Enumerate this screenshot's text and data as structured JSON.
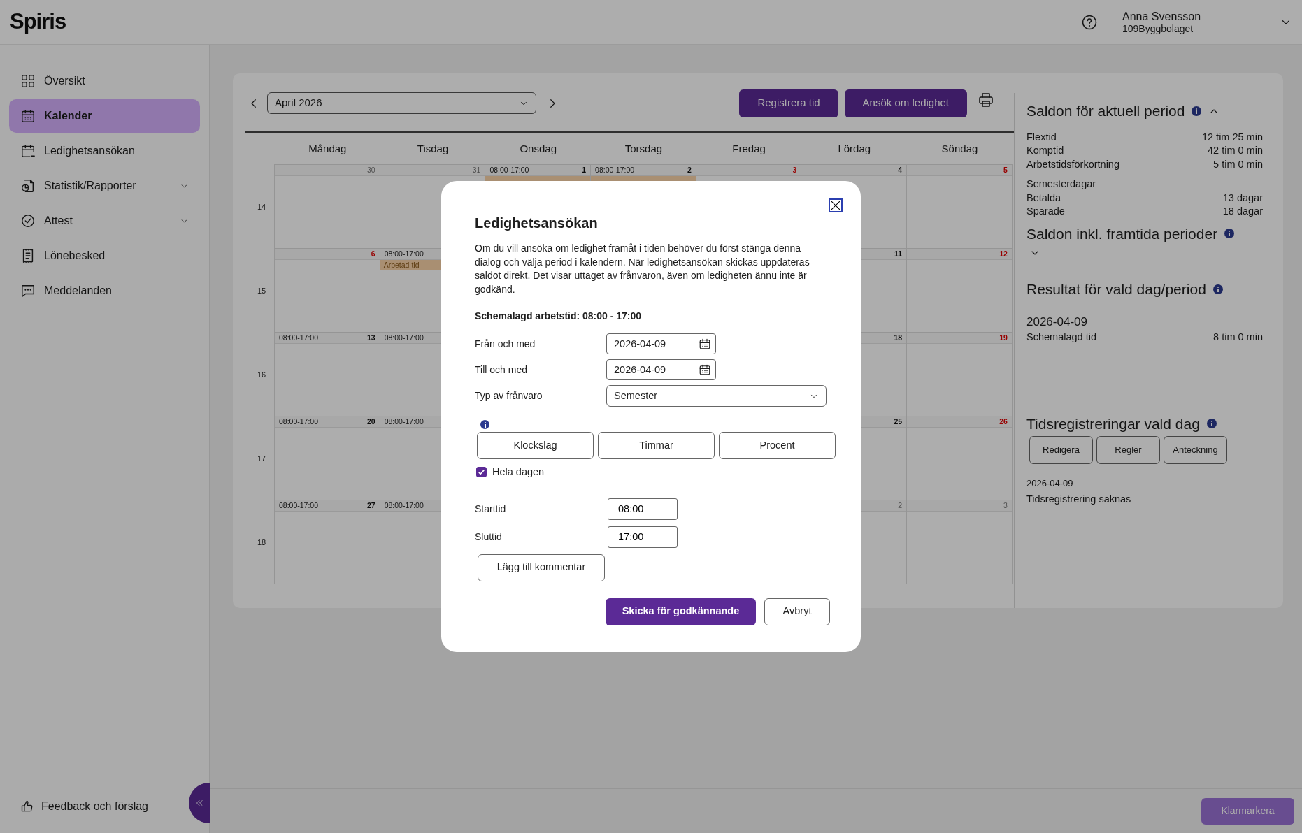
{
  "app": {
    "logo": "Spiris"
  },
  "user": {
    "name": "Anna Svensson",
    "company": "109Byggbolaget"
  },
  "sidebar": {
    "items": [
      {
        "label": "Översikt",
        "selected": false,
        "expandable": false
      },
      {
        "label": "Kalender",
        "selected": true,
        "expandable": false
      },
      {
        "label": "Ledighetsansökan",
        "selected": false,
        "expandable": false
      },
      {
        "label": "Statistik/Rapporter",
        "selected": false,
        "expandable": true
      },
      {
        "label": "Attest",
        "selected": false,
        "expandable": true
      },
      {
        "label": "Lönebesked",
        "selected": false,
        "expandable": false
      },
      {
        "label": "Meddelanden",
        "selected": false,
        "expandable": false
      }
    ],
    "feedback": "Feedback och förslag"
  },
  "calendar": {
    "month": "April 2026",
    "buttons": [
      "Registrera tid",
      "Ansök om ledighet"
    ],
    "weekdays": [
      "Måndag",
      "Tisdag",
      "Onsdag",
      "Torsdag",
      "Fredag",
      "Lördag",
      "Söndag"
    ],
    "weeks": [
      {
        "number": "14",
        "days": [
          {
            "kind": "day",
            "day": "30",
            "holiday": false,
            "other_month": true
          },
          {
            "kind": "day",
            "day": "31",
            "holiday": false,
            "other_month": true
          },
          {
            "kind": "day",
            "time": "08:00-17:00",
            "day": "1",
            "holiday": false,
            "other_month": false,
            "event": true
          },
          {
            "kind": "day",
            "time": "08:00-17:00",
            "day": "2",
            "holiday": false,
            "other_month": false,
            "event": true
          },
          {
            "kind": "day",
            "day": "3",
            "holiday": true,
            "other_month": false
          },
          {
            "kind": "day",
            "day": "4",
            "holiday": false,
            "other_month": false
          },
          {
            "kind": "day",
            "day": "5",
            "holiday": true,
            "other_month": false
          }
        ]
      },
      {
        "number": "15",
        "days": [
          {
            "kind": "day",
            "day": "6",
            "holiday": true,
            "other_month": false
          },
          {
            "kind": "day",
            "time": "08:00-17:00",
            "event": true,
            "event_label": "Arbetad tid"
          },
          {
            "kind": "covered"
          },
          {
            "kind": "covered"
          },
          {
            "kind": "covered"
          },
          {
            "kind": "day",
            "day": "11",
            "holiday": false,
            "other_month": false
          },
          {
            "kind": "day",
            "day": "12",
            "holiday": true,
            "other_month": false
          }
        ]
      },
      {
        "number": "16",
        "days": [
          {
            "kind": "day",
            "time": "08:00-17:00",
            "day": "13",
            "holiday": false,
            "other_month": false
          },
          {
            "kind": "day",
            "time": "08:00-17:00"
          },
          {
            "kind": "covered"
          },
          {
            "kind": "covered"
          },
          {
            "kind": "covered"
          },
          {
            "kind": "day",
            "day": "18",
            "holiday": false,
            "other_month": false
          },
          {
            "kind": "day",
            "day": "19",
            "holiday": true,
            "other_month": false
          }
        ]
      },
      {
        "number": "17",
        "days": [
          {
            "kind": "day",
            "time": "08:00-17:00",
            "day": "20",
            "holiday": false,
            "other_month": false
          },
          {
            "kind": "day",
            "time": "08:00-17:00"
          },
          {
            "kind": "covered"
          },
          {
            "kind": "covered"
          },
          {
            "kind": "covered"
          },
          {
            "kind": "day",
            "day": "25",
            "holiday": false,
            "other_month": false
          },
          {
            "kind": "day",
            "day": "26",
            "holiday": true,
            "other_month": false
          }
        ]
      },
      {
        "number": "18",
        "days": [
          {
            "kind": "day",
            "time": "08:00-17:00",
            "day": "27",
            "holiday": false,
            "other_month": false
          },
          {
            "kind": "day",
            "time": "08:00-17:00"
          },
          {
            "kind": "covered"
          },
          {
            "kind": "covered"
          },
          {
            "kind": "covered"
          },
          {
            "kind": "day",
            "day": "2",
            "holiday": false,
            "other_month": true
          },
          {
            "kind": "day",
            "day": "3",
            "holiday": false,
            "other_month": true
          }
        ]
      }
    ]
  },
  "balances": {
    "title": "Saldon för aktuell period",
    "expanded": true,
    "rows": [
      {
        "label": "Flextid",
        "value": "12 tim 25 min"
      },
      {
        "label": "Komptid",
        "value": "42 tim 0 min"
      },
      {
        "label": "Arbetstidsförkortning",
        "value": "5 tim 0 min"
      }
    ],
    "vacation_title": "Semesterdagar",
    "vacation_rows": [
      {
        "label": "Betalda",
        "value": "13 dagar"
      },
      {
        "label": "Sparade",
        "value": "18 dagar"
      }
    ]
  },
  "future_balances": {
    "title": "Saldon inkl. framtida perioder",
    "expanded": false
  },
  "result": {
    "title": "Resultat för vald dag/period",
    "date": "2026-04-09",
    "rows": [
      {
        "label": "Schemalagd tid",
        "value": "8 tim 0 min"
      }
    ]
  },
  "registrations": {
    "title": "Tidsregistreringar vald dag",
    "buttons": [
      "Redigera",
      "Regler",
      "Anteckning"
    ],
    "date": "2026-04-09",
    "message": "Tidsregistrering saknas"
  },
  "modal": {
    "title": "Ledighetsansökan",
    "text": "Om du vill ansöka om ledighet framåt i tiden behöver du först stänga denna dialog och välja period i kalendern. När ledighetsansökan skickas uppdateras saldot direkt. Det visar uttaget av frånvaron, även om ledigheten ännu inte är godkänd.",
    "schedule": "Schemalagd arbetstid: 08:00 - 17:00",
    "fields": [
      {
        "label": "Från och med",
        "kind": "date",
        "value": "2026-04-09"
      },
      {
        "label": "Till och med",
        "kind": "date",
        "value": "2026-04-09"
      },
      {
        "label": "Typ av frånvaro",
        "kind": "select",
        "value": "Semester"
      }
    ],
    "modes": [
      "Klockslag",
      "Timmar",
      "Procent"
    ],
    "full_day": {
      "label": "Hela dagen",
      "checked": true
    },
    "times": [
      {
        "label": "Starttid",
        "value": "08:00"
      },
      {
        "label": "Sluttid",
        "value": "17:00"
      }
    ],
    "comment_button": "Lägg till kommentar",
    "submit": "Skicka för godkännande",
    "cancel": "Avbryt"
  },
  "footer": {
    "button": {
      "label": "Klarmarkera",
      "disabled": true
    }
  }
}
